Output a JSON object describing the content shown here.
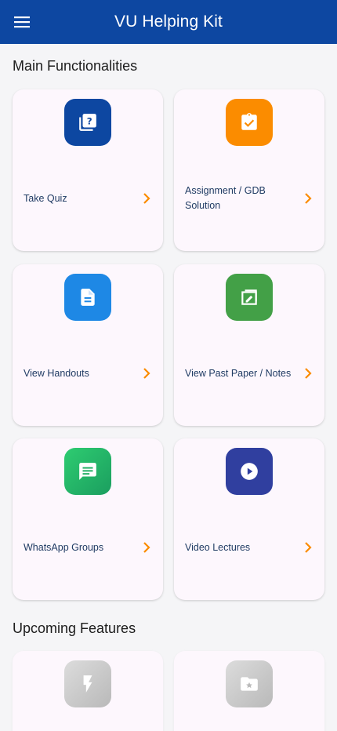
{
  "app": {
    "title": "VU Helping Kit",
    "menu_icon": "menu-icon"
  },
  "sections": {
    "main_title": "Main Functionalities",
    "upcoming_title": "Upcoming Features"
  },
  "colors": {
    "appbar": "#0d47a1",
    "chevron": "#fb8c00",
    "card_label": "#1f3b63"
  },
  "features": [
    {
      "label": "Take Quiz",
      "icon": "quiz-icon",
      "color": "#0d47a1"
    },
    {
      "label": "Assignment / GDB Solution",
      "icon": "clipboard-check-icon",
      "color": "#fb8c00"
    },
    {
      "label": "View Handouts",
      "icon": "document-icon",
      "color": "#1e88e5"
    },
    {
      "label": "View Past Paper / Notes",
      "icon": "notes-icon",
      "color": "#43a047"
    },
    {
      "label": "WhatsApp Groups",
      "icon": "chat-icon",
      "color": "#1fae62"
    },
    {
      "label": "Video Lectures",
      "icon": "play-icon",
      "color": "#303f9f"
    }
  ],
  "upcoming": [
    {
      "icon": "flash-icon"
    },
    {
      "icon": "folder-star-icon"
    }
  ]
}
